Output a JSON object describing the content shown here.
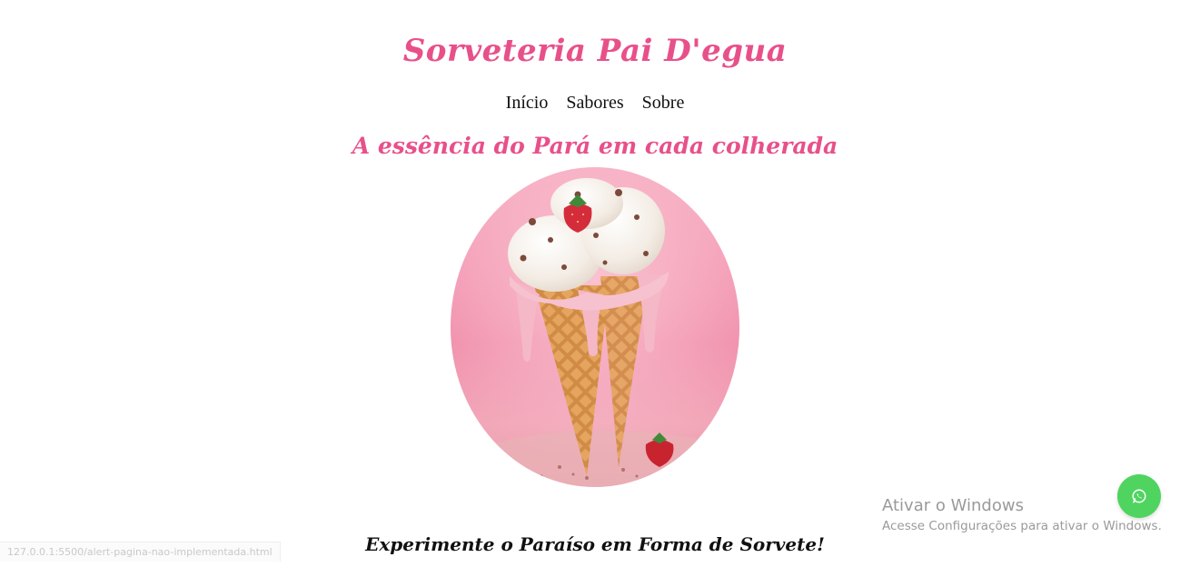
{
  "header": {
    "site_title": "Sorveteria Pai D'egua"
  },
  "nav": {
    "items": [
      {
        "label": "Início"
      },
      {
        "label": "Sabores"
      },
      {
        "label": "Sobre"
      }
    ]
  },
  "hero": {
    "tagline": "A essência do Pará em cada colherada",
    "image_icon": "ice-cream-cone-image"
  },
  "main": {
    "cta_text": "Experimente o Paraíso em Forma de Sorvete!"
  },
  "floating_button": {
    "icon": "whatsapp-icon",
    "color": "#4fd45f"
  },
  "os_overlay": {
    "activate_title": "Ativar o Windows",
    "activate_subtitle": "Acesse Configurações para ativar o Windows."
  },
  "status_bar": {
    "url": "127.0.0.1:5500/alert-pagina-nao-implementada.html"
  },
  "colors": {
    "brand_pink": "#e8508a",
    "text_dark": "#111111"
  }
}
